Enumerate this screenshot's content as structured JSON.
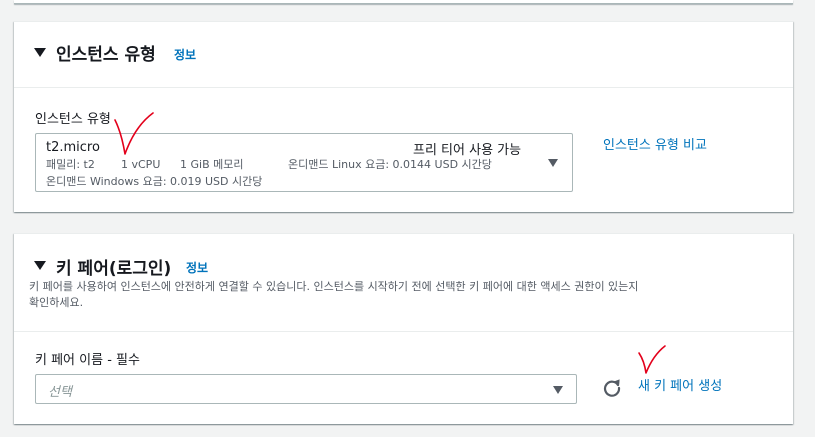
{
  "instance_type_section": {
    "title": "인스턴스 유형",
    "info_link": "정보",
    "field_label": "인스턴스 유형",
    "selected": {
      "name": "t2.micro",
      "free_tier": "프리 티어 사용 가능",
      "family": "패밀리: t2",
      "vcpu": "1 vCPU",
      "memory": "1 GiB 메모리",
      "linux_price": "온디맨드 Linux 요금: 0.0144 USD 시간당",
      "windows_price": "온디맨드 Windows 요금: 0.019 USD 시간당"
    },
    "compare_link": "인스턴스 유형 비교"
  },
  "key_pair_section": {
    "title": "키 페어(로그인)",
    "info_link": "정보",
    "description_line1": "키 페어를 사용하여 인스턴스에 안전하게 연결할 수 있습니다. 인스턴스를 시작하기 전에 선택한 키 페어에 대한 액세스 권한이 있는지",
    "description_line2": "확인하세요.",
    "field_label": "키 페어 이름 - 필수",
    "select_placeholder": "선택",
    "create_link": "새 키 페어 생성"
  },
  "icons": {
    "section_caret": "caret-down-icon",
    "dropdown_arrow": "dropdown-arrow-icon",
    "refresh": "refresh-icon",
    "annotation": "red-check-annotation-icon"
  },
  "colors": {
    "link": "#0073bb",
    "annotation": "#e3001b",
    "background": "#f2f3f3"
  }
}
